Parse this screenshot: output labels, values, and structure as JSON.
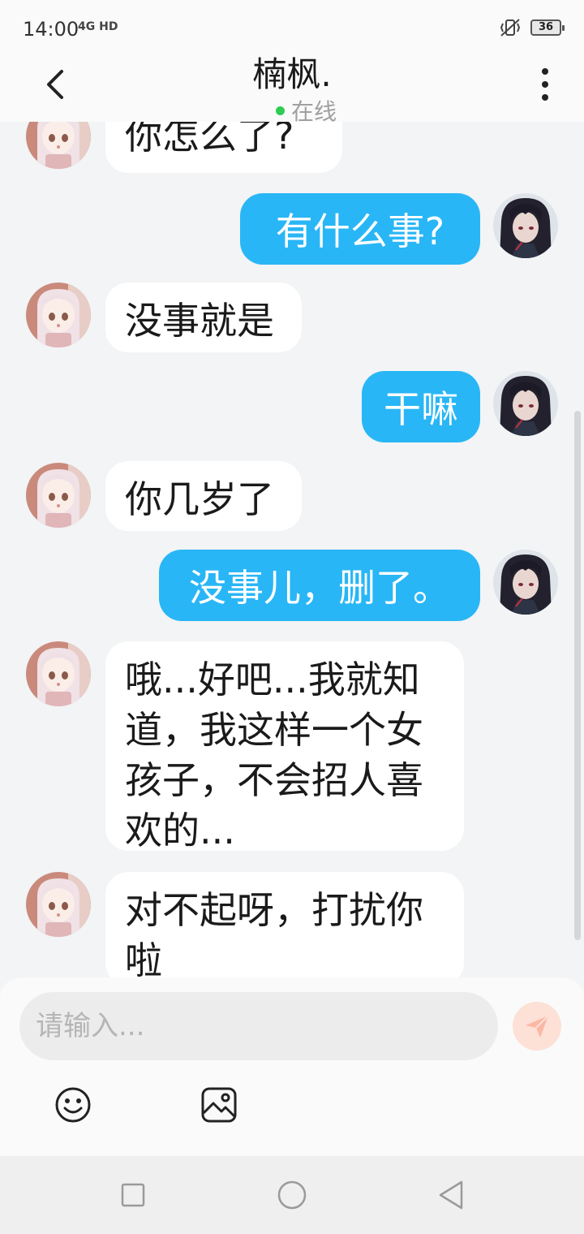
{
  "status_bar": {
    "time": "14:00",
    "network": "4G HD",
    "battery": "36"
  },
  "header": {
    "title": "楠枫.",
    "status": "在线",
    "back_icon": "chevron-left-icon",
    "menu_icon": "more-vertical-icon"
  },
  "messages": [
    {
      "side": "left",
      "text": "你怎么了?"
    },
    {
      "side": "right",
      "text": "有什么事?"
    },
    {
      "side": "left",
      "text": "没事就是"
    },
    {
      "side": "right",
      "text": "干嘛"
    },
    {
      "side": "left",
      "text": "你几岁了"
    },
    {
      "side": "right",
      "text": "没事儿，删了。"
    },
    {
      "side": "left",
      "text": "哦...好吧...我就知道，我这样一个女孩子，不会招人喜欢的..."
    },
    {
      "side": "left",
      "text": "对不起呀，打扰你啦"
    }
  ],
  "composer": {
    "placeholder": "请输入...",
    "send_icon": "send-icon",
    "emoji_icon": "emoji-icon",
    "image_icon": "image-icon"
  },
  "nav": {
    "recent_icon": "square-icon",
    "home_icon": "circle-icon",
    "back_icon": "triangle-back-icon"
  },
  "colors": {
    "accent": "#29b6f6",
    "online": "#2ecc52",
    "background": "#f2f4f5"
  }
}
